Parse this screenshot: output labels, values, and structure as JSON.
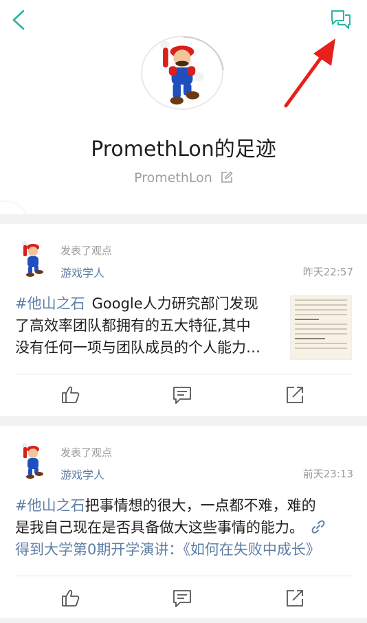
{
  "colors": {
    "accent": "#2bb3a3",
    "link": "#5d7fa6",
    "arrow": "#e8201c"
  },
  "profile": {
    "title": "PromethLon的足迹",
    "username": "PromethLon"
  },
  "posts": [
    {
      "action": "发表了观点",
      "author": "游戏学人",
      "time": "昨天22:57",
      "hashtag": "#他山之石",
      "line1": "Google人力研究部门发现",
      "line2": "了高效率团队都拥有的五大特征,其中",
      "line3": "没有任何一项与团队成员的个人能力…"
    },
    {
      "action": "发表了观点",
      "author": "游戏学人",
      "time": "前天23:13",
      "hashtag": "#他山之石",
      "line1": "把事情想的很大，一点都不难，难的",
      "line2": "是我自己现在是否具备做大这些事情的能力。",
      "link": "得到大学第0期开学演讲：《如何在失败中成长》"
    }
  ],
  "icons": [
    "back-arrow-icon",
    "message-icon",
    "edit-icon",
    "like-icon",
    "comment-icon",
    "share-icon",
    "link-icon",
    "side-tab-icon"
  ]
}
